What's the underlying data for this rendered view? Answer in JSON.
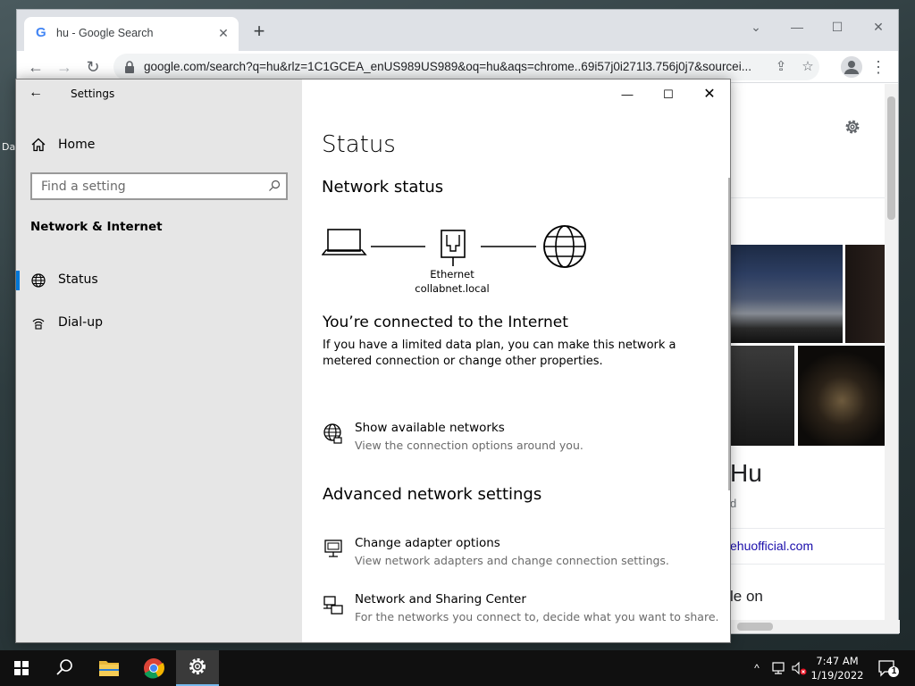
{
  "desktop": {
    "label": "Da"
  },
  "browser": {
    "tab_title": "hu - Google Search",
    "tab_favicon": "G",
    "new_tab": "+",
    "url": "google.com/search?q=hu&rlz=1C1GCEA_enUS989US989&oq=hu&aqs=chrome..69i57j0i271l3.756j0j7&sourcei...",
    "icons": [
      "back-icon",
      "forward-icon",
      "reload-icon",
      "lock-icon",
      "share-icon",
      "star-icon",
      "profile-icon",
      "menu-icon"
    ]
  },
  "google": {
    "title": "Hu",
    "subtitle": "d",
    "link": "ehuofficial.com",
    "text": "le on"
  },
  "settings": {
    "window_title": "Settings",
    "home_label": "Home",
    "search_placeholder": "Find a setting",
    "section_title": "Network & Internet",
    "nav_items": [
      {
        "label": "Status",
        "icon": "globe-icon",
        "active": true
      },
      {
        "label": "Dial-up",
        "icon": "dialup-icon",
        "active": false
      }
    ],
    "page_title": "Status",
    "network_status_heading": "Network status",
    "adapter_name": "Ethernet",
    "adapter_domain": "collabnet.local",
    "connected_heading": "You’re connected to the Internet",
    "connected_desc": "If you have a limited data plan, you can make this network a metered connection or change other properties.",
    "show_networks": {
      "title": "Show available networks",
      "desc": "View the connection options around you."
    },
    "advanced_heading": "Advanced network settings",
    "adapter_options": {
      "title": "Change adapter options",
      "desc": "View network adapters and change connection settings."
    },
    "sharing_center": {
      "title": "Network and Sharing Center",
      "desc": "For the networks you connect to, decide what you want to share."
    }
  },
  "taskbar": {
    "time": "7:47 AM",
    "date": "1/19/2022",
    "notification_count": "1"
  },
  "colors": {
    "accent": "#0078d7",
    "settings_sidebar": "#e6e6e6",
    "taskbar": "#101010"
  }
}
